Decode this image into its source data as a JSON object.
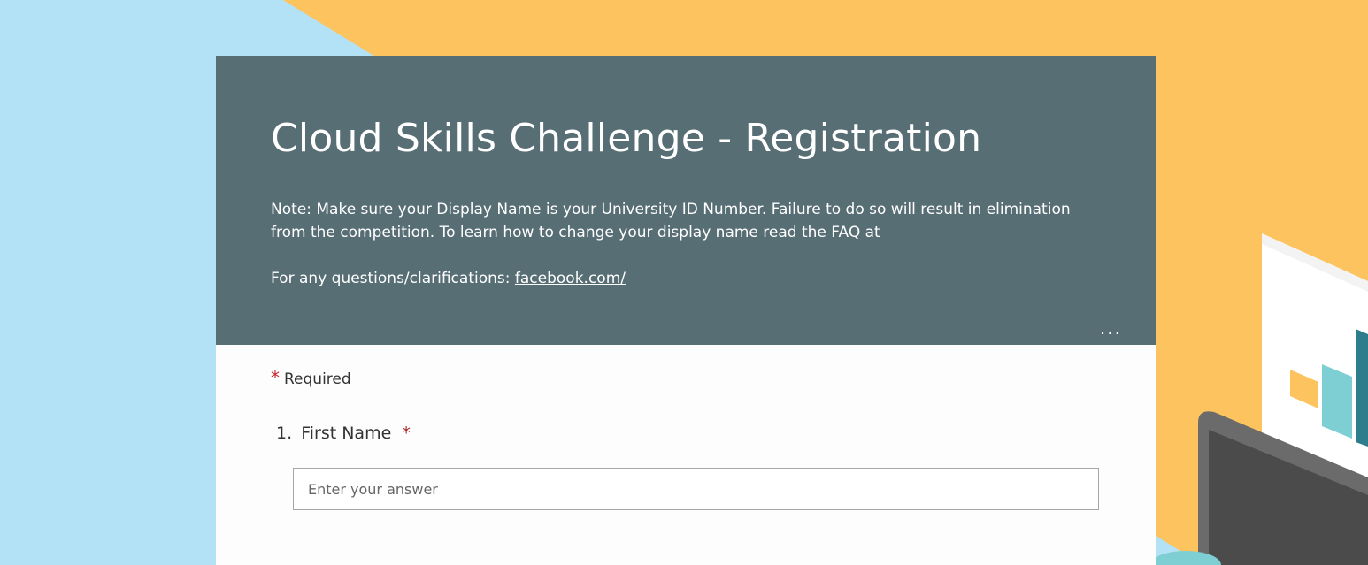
{
  "form": {
    "title": "Cloud Skills Challenge - Registration",
    "note": "Note: Make sure your Display Name is your University ID Number. Failure to do so will result in elimination from the competition. To learn how to change your display name read the FAQ at",
    "contact_label": "For any questions/clarifications:",
    "contact_link": "facebook.com/",
    "more_options": "...",
    "required_star": "*",
    "required_label": "Required"
  },
  "questions": [
    {
      "number": "1.",
      "label": "First Name",
      "required_star": "*",
      "placeholder": "Enter your answer",
      "value": ""
    }
  ],
  "colors": {
    "header": "#586e75",
    "background_blue": "#b3e1f5",
    "background_orange": "#fdc35e",
    "required_red": "#c4262e"
  }
}
